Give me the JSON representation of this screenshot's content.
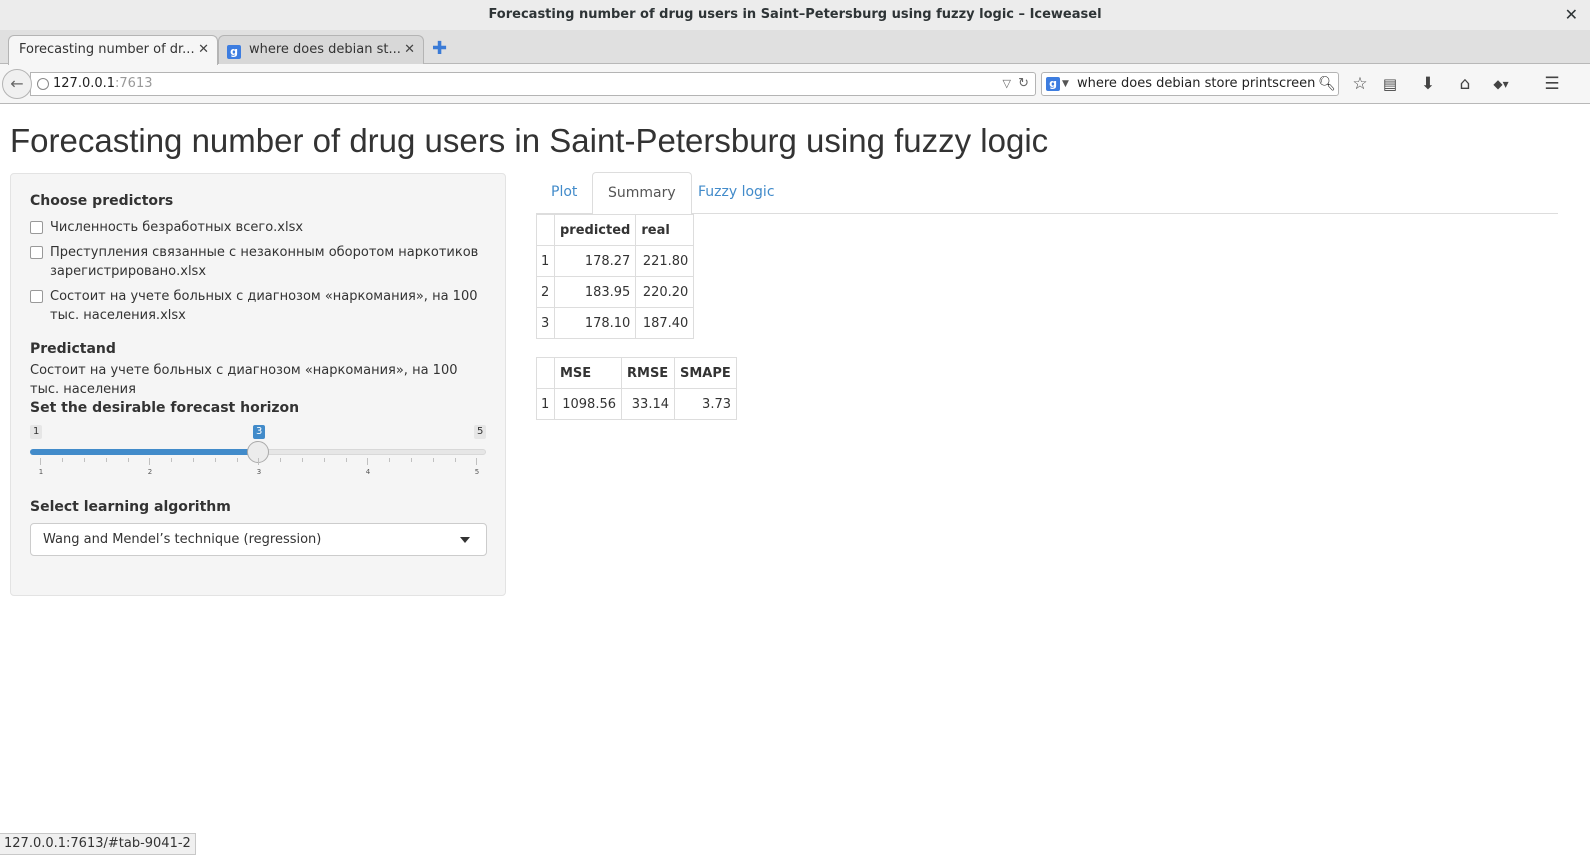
{
  "window": {
    "title": "Forecasting number of drug users in Saint–Petersburg using fuzzy logic – Iceweasel"
  },
  "tabs": [
    {
      "label": "Forecasting number of dr..."
    },
    {
      "label": "where does debian st..."
    }
  ],
  "urlbar": {
    "host": "127.0.0.1",
    "port": ":7613"
  },
  "searchbar": {
    "value": "where does debian store printscreen"
  },
  "page": {
    "title": "Forecasting number of drug users in Saint-Petersburg using fuzzy logic"
  },
  "sidebar": {
    "predictors_heading": "Choose predictors",
    "predictors": [
      {
        "label": "Численность безработных всего.xlsx",
        "checked": false
      },
      {
        "label": "Преступления связанные с незаконным оборотом наркотиков зарегистрировано.xlsx",
        "checked": false
      },
      {
        "label": "Состоит на учете больных с диагнозом «наркомания», на 100 тыс. населения.xlsx",
        "checked": false
      }
    ],
    "predictand_heading": "Predictand",
    "predictand_text": "Состоит на учете больных с диагнозом «наркомания», на 100 тыс. населения",
    "horizon_heading": "Set the desirable forecast horizon",
    "slider": {
      "min": "1",
      "max": "5",
      "value": "3",
      "tick_labels": [
        "1",
        "2",
        "3",
        "4",
        "5"
      ]
    },
    "algorithm_heading": "Select learning algorithm",
    "algorithm_selected": "Wang and Mendel’s technique (regression)"
  },
  "main_tabs": [
    {
      "label": "Plot",
      "active": false
    },
    {
      "label": "Summary",
      "active": true
    },
    {
      "label": "Fuzzy logic",
      "active": false
    }
  ],
  "predictions_table": {
    "headers": [
      "",
      "predicted",
      "real"
    ],
    "rows": [
      [
        "1",
        "178.27",
        "221.80"
      ],
      [
        "2",
        "183.95",
        "220.20"
      ],
      [
        "3",
        "178.10",
        "187.40"
      ]
    ]
  },
  "metrics_table": {
    "headers": [
      "",
      "MSE",
      "RMSE",
      "SMAPE"
    ],
    "rows": [
      [
        "1",
        "1098.56",
        "33.14",
        "3.73"
      ]
    ]
  },
  "statusbar": {
    "text": "127.0.0.1:7613/#tab-9041-2"
  },
  "colors": {
    "accent": "#428bca",
    "link": "#428bca",
    "panel_bg": "#f5f5f5"
  }
}
